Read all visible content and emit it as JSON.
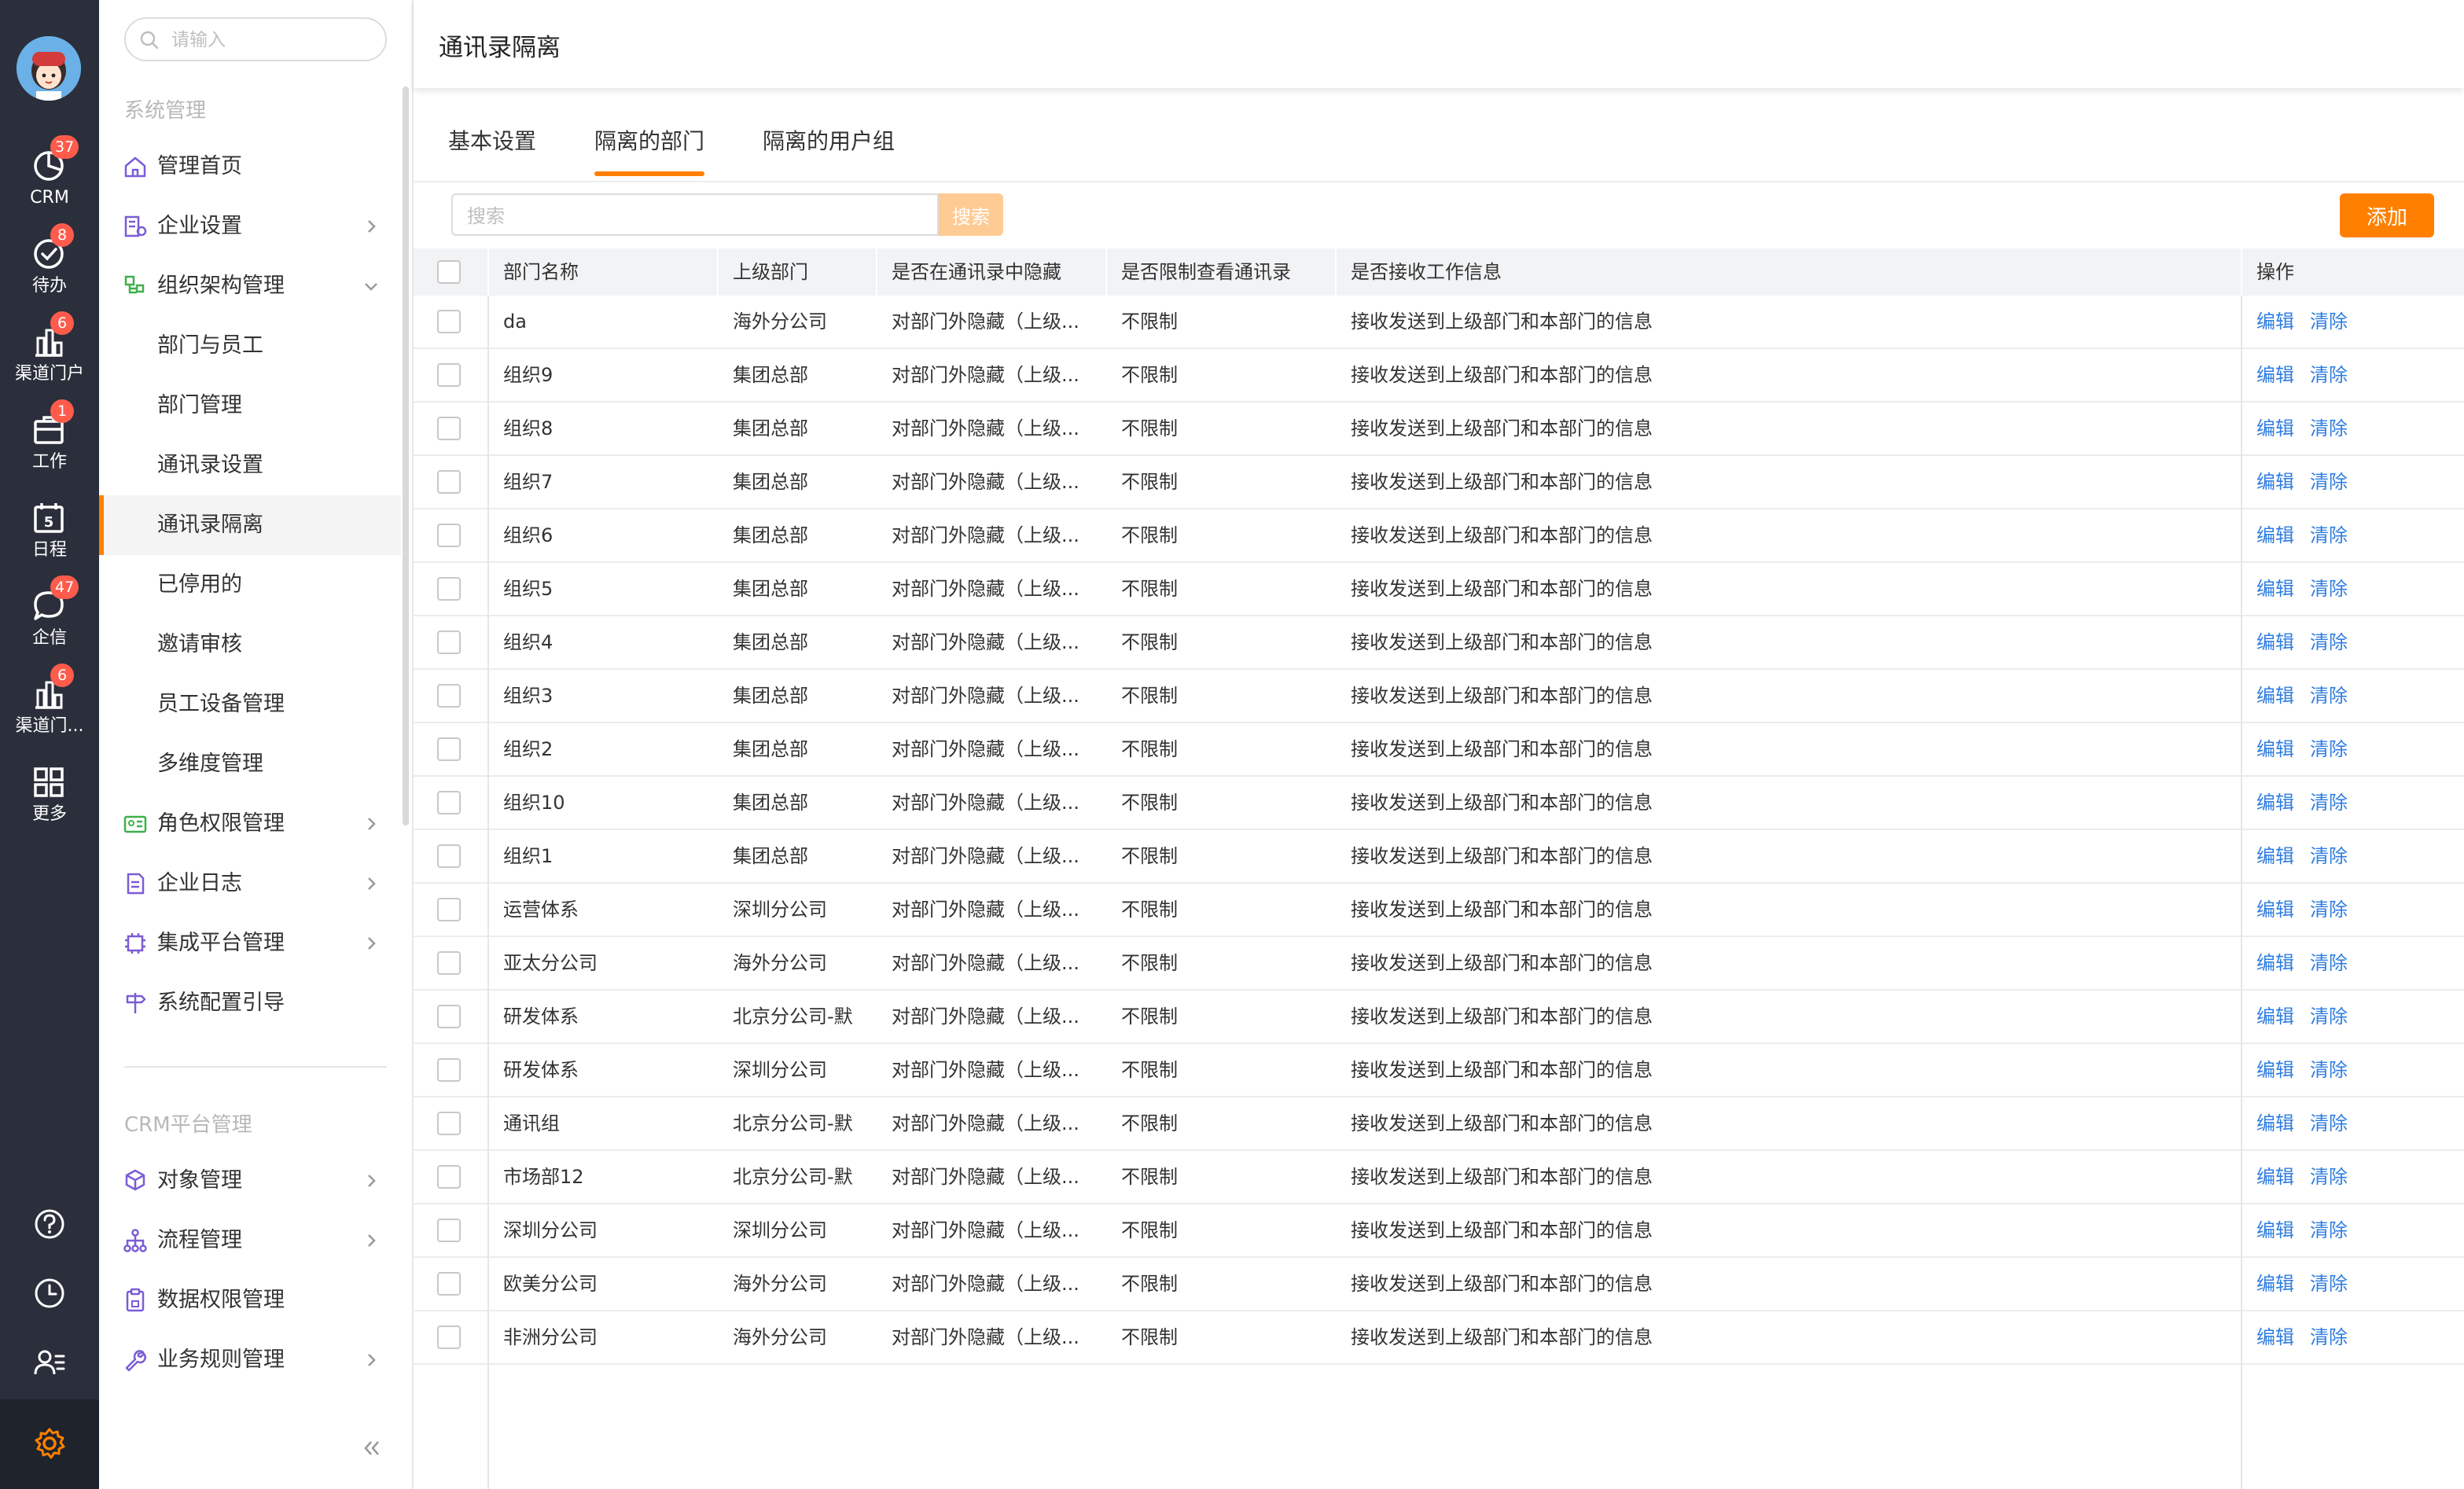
{
  "rail": {
    "items": [
      {
        "label": "CRM",
        "icon": "pie-chart-icon",
        "badge": "37"
      },
      {
        "label": "待办",
        "icon": "check-circle-icon",
        "badge": "8"
      },
      {
        "label": "渠道门户",
        "icon": "building-chart-icon",
        "badge": "6"
      },
      {
        "label": "工作",
        "icon": "briefcase-icon",
        "badge": "1"
      },
      {
        "label": "日程",
        "icon": "calendar-icon",
        "badge": ""
      },
      {
        "label": "企信",
        "icon": "chat-bubble-icon",
        "badge": "47"
      },
      {
        "label": "渠道门...",
        "icon": "building-chart-icon",
        "badge": "6"
      },
      {
        "label": "更多",
        "icon": "grid-icon",
        "badge": ""
      }
    ],
    "calendar_day": "5",
    "bottom_icons": [
      "help-icon",
      "clock-icon",
      "user-list-icon",
      "gear-icon"
    ]
  },
  "sidebar": {
    "search_placeholder": "请输入",
    "group1_title": "系统管理",
    "group2_title": "CRM平台管理",
    "menu": {
      "home": "管理首页",
      "enterprise": "企业设置",
      "org": "组织架构管理",
      "org_children": [
        "部门与员工",
        "部门管理",
        "通讯录设置",
        "通讯录隔离",
        "已停用的",
        "邀请审核",
        "员工设备管理",
        "多维度管理"
      ],
      "role": "角色权限管理",
      "log": "企业日志",
      "integration": "集成平台管理",
      "guide": "系统配置引导",
      "object": "对象管理",
      "flow": "流程管理",
      "data_perm": "数据权限管理",
      "rules": "业务规则管理"
    }
  },
  "page": {
    "title": "通讯录隔离",
    "tabs": [
      "基本设置",
      "隔离的部门",
      "隔离的用户组"
    ],
    "active_tab": 1,
    "search_placeholder": "搜索",
    "search_button": "搜索",
    "add_button": "添加"
  },
  "colors": {
    "accent": "#ff8000",
    "link": "#2f7de1",
    "badge": "#ff5b4c",
    "rail_bg": "#2a2f3b"
  },
  "table": {
    "headers": [
      "部门名称",
      "上级部门",
      "是否在通讯录中隐藏",
      "是否限制查看通讯录",
      "是否接收工作信息",
      "操作"
    ],
    "action_edit": "编辑",
    "action_clear": "清除",
    "rows": [
      {
        "name": "da",
        "parent": "海外分公司",
        "hidden": "对部门外隐藏（上级...",
        "restrict": "不限制",
        "receive": "接收发送到上级部门和本部门的信息"
      },
      {
        "name": "组织9",
        "parent": "集团总部",
        "hidden": "对部门外隐藏（上级...",
        "restrict": "不限制",
        "receive": "接收发送到上级部门和本部门的信息"
      },
      {
        "name": "组织8",
        "parent": "集团总部",
        "hidden": "对部门外隐藏（上级...",
        "restrict": "不限制",
        "receive": "接收发送到上级部门和本部门的信息"
      },
      {
        "name": "组织7",
        "parent": "集团总部",
        "hidden": "对部门外隐藏（上级...",
        "restrict": "不限制",
        "receive": "接收发送到上级部门和本部门的信息"
      },
      {
        "name": "组织6",
        "parent": "集团总部",
        "hidden": "对部门外隐藏（上级...",
        "restrict": "不限制",
        "receive": "接收发送到上级部门和本部门的信息"
      },
      {
        "name": "组织5",
        "parent": "集团总部",
        "hidden": "对部门外隐藏（上级...",
        "restrict": "不限制",
        "receive": "接收发送到上级部门和本部门的信息"
      },
      {
        "name": "组织4",
        "parent": "集团总部",
        "hidden": "对部门外隐藏（上级...",
        "restrict": "不限制",
        "receive": "接收发送到上级部门和本部门的信息"
      },
      {
        "name": "组织3",
        "parent": "集团总部",
        "hidden": "对部门外隐藏（上级...",
        "restrict": "不限制",
        "receive": "接收发送到上级部门和本部门的信息"
      },
      {
        "name": "组织2",
        "parent": "集团总部",
        "hidden": "对部门外隐藏（上级...",
        "restrict": "不限制",
        "receive": "接收发送到上级部门和本部门的信息"
      },
      {
        "name": "组织10",
        "parent": "集团总部",
        "hidden": "对部门外隐藏（上级...",
        "restrict": "不限制",
        "receive": "接收发送到上级部门和本部门的信息"
      },
      {
        "name": "组织1",
        "parent": "集团总部",
        "hidden": "对部门外隐藏（上级...",
        "restrict": "不限制",
        "receive": "接收发送到上级部门和本部门的信息"
      },
      {
        "name": "运营体系",
        "parent": "深圳分公司",
        "hidden": "对部门外隐藏（上级...",
        "restrict": "不限制",
        "receive": "接收发送到上级部门和本部门的信息"
      },
      {
        "name": "亚太分公司",
        "parent": "海外分公司",
        "hidden": "对部门外隐藏（上级...",
        "restrict": "不限制",
        "receive": "接收发送到上级部门和本部门的信息"
      },
      {
        "name": "研发体系",
        "parent": "北京分公司-默",
        "hidden": "对部门外隐藏（上级...",
        "restrict": "不限制",
        "receive": "接收发送到上级部门和本部门的信息"
      },
      {
        "name": "研发体系",
        "parent": "深圳分公司",
        "hidden": "对部门外隐藏（上级...",
        "restrict": "不限制",
        "receive": "接收发送到上级部门和本部门的信息"
      },
      {
        "name": "通讯组",
        "parent": "北京分公司-默",
        "hidden": "对部门外隐藏（上级...",
        "restrict": "不限制",
        "receive": "接收发送到上级部门和本部门的信息"
      },
      {
        "name": "市场部12",
        "parent": "北京分公司-默",
        "hidden": "对部门外隐藏（上级...",
        "restrict": "不限制",
        "receive": "接收发送到上级部门和本部门的信息"
      },
      {
        "name": "深圳分公司",
        "parent": "深圳分公司",
        "hidden": "对部门外隐藏（上级...",
        "restrict": "不限制",
        "receive": "接收发送到上级部门和本部门的信息"
      },
      {
        "name": "欧美分公司",
        "parent": "海外分公司",
        "hidden": "对部门外隐藏（上级...",
        "restrict": "不限制",
        "receive": "接收发送到上级部门和本部门的信息"
      },
      {
        "name": "非洲分公司",
        "parent": "海外分公司",
        "hidden": "对部门外隐藏（上级...",
        "restrict": "不限制",
        "receive": "接收发送到上级部门和本部门的信息"
      }
    ]
  }
}
